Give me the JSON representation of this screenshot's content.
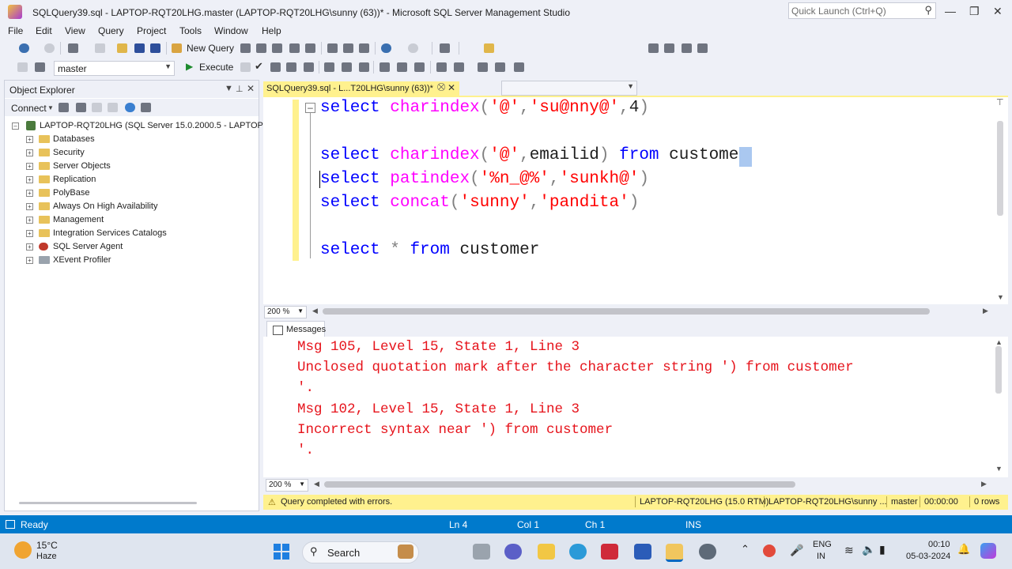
{
  "window": {
    "title": "SQLQuery39.sql - LAPTOP-RQT20LHG.master (LAPTOP-RQT20LHG\\sunny (63))* - Microsoft SQL Server Management Studio",
    "quick_launch_placeholder": "Quick Launch (Ctrl+Q)"
  },
  "menu": [
    "File",
    "Edit",
    "View",
    "Query",
    "Project",
    "Tools",
    "Window",
    "Help"
  ],
  "toolbar": {
    "new_query_label": "New Query",
    "execute_label": "Execute",
    "database_value": "master"
  },
  "object_explorer": {
    "title": "Object Explorer",
    "connect_label": "Connect",
    "server_node": "LAPTOP-RQT20LHG (SQL Server 15.0.2000.5 - LAPTOP-R",
    "nodes": [
      "Databases",
      "Security",
      "Server Objects",
      "Replication",
      "PolyBase",
      "Always On High Availability",
      "Management",
      "Integration Services Catalogs",
      "SQL Server Agent",
      "XEvent Profiler"
    ]
  },
  "editor": {
    "tab_label": "SQLQuery39.sql - L...T20LHG\\sunny (63))*",
    "zoom": "200 %"
  },
  "messages": {
    "tab_label": "Messages",
    "lines": [
      "Msg 105, Level 15, State 1, Line 3",
      "Unclosed quotation mark after the character string ') from customer",
      "'.",
      "Msg 102, Level 15, State 1, Line 3",
      "Incorrect syntax near ') from customer",
      "'."
    ],
    "zoom": "200 %"
  },
  "query_status": {
    "message": "Query completed with errors.",
    "server": "LAPTOP-RQT20LHG (15.0 RTM)",
    "user": "LAPTOP-RQT20LHG\\sunny ...",
    "database": "master",
    "elapsed": "00:00:00",
    "rows": "0 rows"
  },
  "status_bar": {
    "state": "Ready",
    "ln": "Ln 4",
    "col": "Col 1",
    "ch": "Ch 1",
    "mode": "INS"
  },
  "taskbar": {
    "weather_temp": "15°C",
    "weather_desc": "Haze",
    "search_label": "Search",
    "lang_1": "ENG",
    "lang_2": "IN",
    "time": "00:10",
    "date": "05-03-2024"
  },
  "colors": {
    "accent": "#007acc",
    "tab_yellow": "#fff18e",
    "keyword": "#0000ff",
    "function": "#ff00ff",
    "string": "#ff0000",
    "error": "#e6131b"
  }
}
